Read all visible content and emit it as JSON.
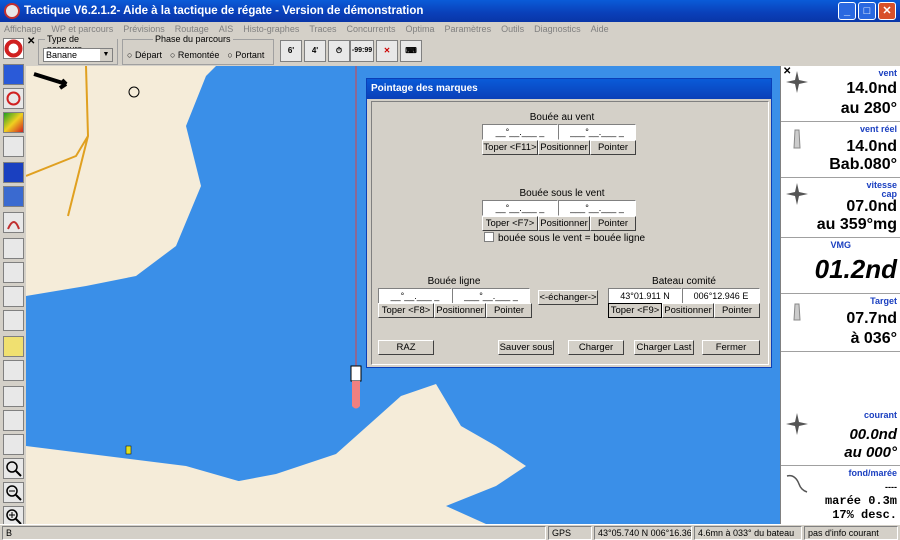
{
  "window": {
    "title": "Tactique V6.2.1.2- Aide à la tactique de régate - Version de démonstration",
    "minimize": "_",
    "maximize": "□",
    "close": "✕"
  },
  "menu": [
    "Affichage",
    "WP et parcours",
    "Prévisions",
    "Routage",
    "AIS",
    "Histo-graphes",
    "Traces",
    "Concurrents",
    "Optima",
    "Paramètres",
    "Outils",
    "Diagnostics",
    "Aide"
  ],
  "toolbar": {
    "close_x": "✕",
    "type_parcours_label": "Type de parcours",
    "type_parcours_value": "Banane",
    "phase_label": "Phase du parcours",
    "phase_options": [
      "Départ",
      "Remontée",
      "Portant"
    ],
    "icon_6": "6'",
    "icon_4": "4'",
    "timer_text": "-99:99"
  },
  "dialog": {
    "title": "Pointage des marques",
    "bouee_vent": {
      "label": "Bouée au vent",
      "lat": "__°__.___ _",
      "lon": "___°__.___ _",
      "toper": "Toper <F11>",
      "positionner": "Positionner",
      "pointer": "Pointer"
    },
    "bouee_sous_vent": {
      "label": "Bouée sous le vent",
      "lat": "__°__.___ _",
      "lon": "___°__.___ _",
      "toper": "Toper <F7>",
      "positionner": "Positionner",
      "pointer": "Pointer"
    },
    "checkbox_label": "bouée sous le vent = bouée ligne",
    "bouee_ligne": {
      "label": "Bouée ligne",
      "lat": "__°__.___ _",
      "lon": "___°__.___ _",
      "toper": "Toper <F8>",
      "positionner": "Positionner",
      "pointer": "Pointer"
    },
    "echanger": "<-échanger->",
    "bateau_comite": {
      "label": "Bateau comité",
      "lat": "43°01.911 N",
      "lon": "006°12.946 E",
      "toper": "Toper <F9>",
      "positionner": "Positionner",
      "pointer": "Pointer"
    },
    "buttons": {
      "raz": "RAZ",
      "sauver": "Sauver sous",
      "charger": "Charger",
      "charger_last": "Charger Last",
      "fermer": "Fermer"
    }
  },
  "panel": {
    "close_x": "✕",
    "vent": {
      "label": "vent",
      "line1": "14.0nd",
      "line2": "au 280°"
    },
    "vent_reel": {
      "label": "vent réel",
      "line1": "14.0nd",
      "line2": "Bab.080°"
    },
    "vitesse": {
      "label1": "vitesse",
      "label2": "cap",
      "line1": "07.0nd",
      "line2": "au 359°mg"
    },
    "vmg": {
      "label": "VMG",
      "value": "01.2nd"
    },
    "target": {
      "label": "Target",
      "line1": "07.7nd",
      "line2": "à 036°"
    },
    "courant": {
      "label": "courant",
      "line1": "00.0nd",
      "line2": "au 000°"
    },
    "fond": {
      "label": "fond/marée",
      "dash": "----",
      "line1": "marée 0.3m",
      "line2": "17% desc."
    }
  },
  "status": {
    "left": "B",
    "gps": "GPS",
    "position": "43°05.740 N  006°16.360 E",
    "distance": "4.6mn à 033° du bateau",
    "info": "pas d'info courant"
  },
  "colors": {
    "sea": "#3a8fe8",
    "land": "#f5ecd9",
    "title_blue": "#0a3fb8",
    "panel_label": "#1a3fc0"
  }
}
